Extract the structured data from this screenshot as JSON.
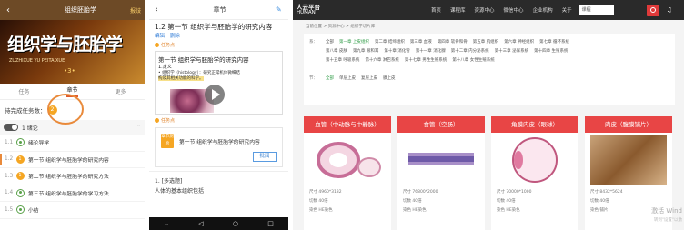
{
  "panel1": {
    "title": "组织胚胎学",
    "action": "报歧",
    "cover_title": "组织学与胚胎学",
    "cover_subtitle": "ZUZHIXUE YU PEITAIXUE",
    "cover_edition": "•3•",
    "tabs": [
      "任务",
      "章节",
      "更多"
    ],
    "active_tab": "章节",
    "pending_label": "待完成任务数：",
    "pending_count": "2",
    "section_label": "1 绪论",
    "rows": [
      {
        "num": "1.1",
        "label": "绪论导学",
        "badge": ""
      },
      {
        "num": "1.2",
        "label": "第一节 组织学与胚胎学的研究内容",
        "badge": "1"
      },
      {
        "num": "1.3",
        "label": "第二节 组织学与胚胎学的研究方法",
        "badge": "1"
      },
      {
        "num": "1.4",
        "label": "第三节 组织学与胚胎学的学习方法",
        "badge": ""
      },
      {
        "num": "1.5",
        "label": "小结",
        "badge": ""
      }
    ]
  },
  "panel2": {
    "title": "章节",
    "heading": "1.2 第一节 组织学与胚胎学的研究内容",
    "links": [
      "编辑",
      "删除"
    ],
    "task_point": "任务点",
    "video_title": "第一节 组织学与胚胎学的研究内容",
    "video_sub": "1.定义",
    "video_bullet1": "• 组织学（histology）：研究正常机体微细结",
    "video_bullet2": "构及其相关功能的科学。",
    "task_badge": "章节测验",
    "task_title": "第一节 组织学与胚胎学的研究内容",
    "grade_button": "批阅",
    "quiz_type": "1. [多选题]",
    "quiz_question": "人体的基本组织包括"
  },
  "panel3": {
    "logo_top": "人云平台",
    "logo_bottom": "HUMAN",
    "nav": [
      "首页",
      "课程库",
      "资源中心",
      "微信中心",
      "企业机构",
      "关于"
    ],
    "select": "课程",
    "breadcrumb": "当前位置 > 资源中心 > 组织学切片库",
    "filter_label1": "系：",
    "filter_row1": [
      "全部",
      "第一章 上皮组织",
      "第二章 结缔组织",
      "第三章 血液",
      "第四章 软骨和骨",
      "第五章 肌组织",
      "第六章 神经组织",
      "第七章 循环系统"
    ],
    "filter_row2": [
      "第八章 皮肤",
      "第九章 眼和耳",
      "第十章 消化管",
      "第十一章 消化腺",
      "第十二章 内分泌系统",
      "第十三章 泌尿系统",
      "第十四章 生殖系统"
    ],
    "filter_row3": [
      "第十五章 呼吸系统",
      "第十六章 淋巴系统",
      "第十七章 男性生殖系统",
      "第十八章 女性生殖系统"
    ],
    "filter_label2": "节：",
    "filter_row4": [
      "全部",
      "单层上皮",
      "复层上皮",
      "腺上皮"
    ],
    "cards": [
      {
        "title": "血管（中动脉与中静脉）",
        "size": "尺寸 4960*3132",
        "cut": "切数 40倍",
        "stain": "染色 HE染色"
      },
      {
        "title": "食管（空肠）",
        "size": "尺寸 76800*2000",
        "cut": "切数 40倍",
        "stain": "染色 HE染色"
      },
      {
        "title": "角膜内皮（眼球）",
        "size": "尺寸 70000*1000",
        "cut": "切数 40倍",
        "stain": "染色 HE染色"
      },
      {
        "title": "肉皮（腹膜铺片）",
        "size": "尺寸 8432*5624",
        "cut": "切数 40倍",
        "stain": "染色 铺片"
      }
    ],
    "watermark": "激活 Wind",
    "watermark_sub": "转到\"设置\"以激"
  },
  "colors": {
    "brown": "#6d4a26",
    "orange": "#f5a623",
    "red": "#e84545",
    "green": "#2e9b45",
    "blue": "#2f7bd6"
  }
}
